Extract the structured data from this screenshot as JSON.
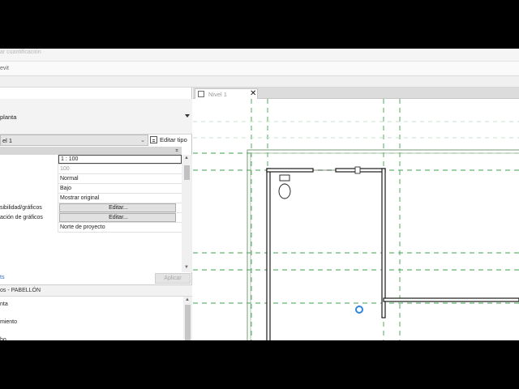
{
  "ribbon": {
    "quantification_label": "ar cuantificación",
    "revit_tab_fragment": "evit"
  },
  "properties": {
    "type_name": "planta",
    "level_selector": "el 1",
    "edit_type_label": "Editar tipo",
    "rows": [
      {
        "key": "",
        "value": "1 : 100"
      },
      {
        "key": "",
        "value": "100"
      },
      {
        "key": "",
        "value": "Normal"
      },
      {
        "key": "",
        "value": "Bajo"
      },
      {
        "key": "",
        "value": "Mostrar original"
      },
      {
        "key": "sibilidad/gráficos",
        "value": "Editar..."
      },
      {
        "key": "ación de gráficos",
        "value": "Editar..."
      },
      {
        "key": "",
        "value": "Norte de proyecto"
      }
    ],
    "help_link": "ts",
    "apply_label": "Aplicar"
  },
  "browser": {
    "title": "os - PABELLÓN",
    "items": [
      "nta",
      "miento",
      "ho"
    ]
  },
  "view": {
    "tab_label": "Nivel 1",
    "close_glyph": "✕"
  },
  "colors": {
    "wall": "#1a1a1a",
    "grid_line": "#3fa34d",
    "crop_region": "#7a9a7a",
    "cursor": "#2e86de"
  },
  "icons": [
    "floor-plan-icon",
    "dropdown-arrow-icon",
    "edit-type-icon",
    "collapse-icon",
    "close-icon",
    "scroll-up-icon",
    "scroll-down-icon",
    "toilet-icon",
    "cursor-icon"
  ]
}
